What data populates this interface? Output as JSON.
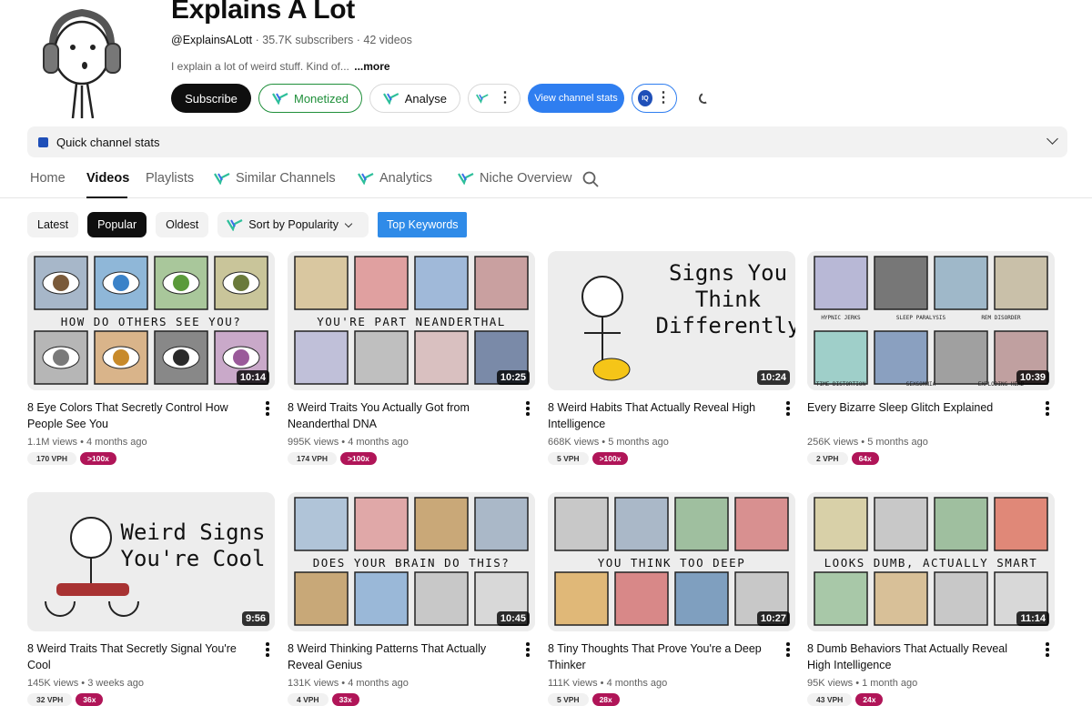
{
  "channel": {
    "name": "Explains A Lot",
    "handle": "@ExplainsALott",
    "stats": "· 35.7K subscribers · 42 videos",
    "description": "I explain a lot of weird stuff. Kind of...",
    "more_label": "...more"
  },
  "actions": {
    "subscribe": "Subscribe",
    "monetized": "Monetized",
    "analyse": "Analyse",
    "view_stats": "View channel stats",
    "vq_badge": "IQ"
  },
  "quick_stats": {
    "label": "Quick channel stats"
  },
  "tabs": {
    "home": "Home",
    "videos": "Videos",
    "playlists": "Playlists",
    "similar": "Similar Channels",
    "analytics": "Analytics",
    "niche": "Niche Overview"
  },
  "filters": {
    "latest": "Latest",
    "popular": "Popular",
    "oldest": "Oldest",
    "sort": "Sort by Popularity",
    "keywords": "Top Keywords"
  },
  "colors": {
    "accent_blue": "#2f7ef0",
    "monetized_green": "#1f8f3a",
    "badge_red": "#b01558"
  },
  "videos": [
    {
      "title": "8 Eye Colors That Secretly Control How People See You",
      "meta": "1.1M views • 4 months ago",
      "vph": "170 VPH",
      "mult": ">100x",
      "duration": "10:14",
      "thumb_text": "HOW DO OTHERS SEE YOU?"
    },
    {
      "title": "8 Weird Traits You Actually Got from Neanderthal DNA",
      "meta": "995K views • 4 months ago",
      "vph": "174 VPH",
      "mult": ">100x",
      "duration": "10:25",
      "thumb_text": "YOU'RE PART NEANDERTHAL"
    },
    {
      "title": "8 Weird Habits That Actually Reveal High Intelligence",
      "meta": "668K views • 5 months ago",
      "vph": "5 VPH",
      "mult": ">100x",
      "duration": "10:24",
      "thumb_text": "Signs You Think Differently"
    },
    {
      "title": "Every Bizarre Sleep Glitch Explained",
      "meta": "256K views • 5 months ago",
      "vph": "2 VPH",
      "mult": "64x",
      "duration": "10:39",
      "thumb_text": ""
    },
    {
      "title": "8 Weird Traits That Secretly Signal You're Cool",
      "meta": "145K views • 3 weeks ago",
      "vph": "32 VPH",
      "mult": "36x",
      "duration": "9:56",
      "thumb_text": "Weird Signs You're Cool"
    },
    {
      "title": "8 Weird Thinking Patterns That Actually Reveal Genius",
      "meta": "131K views • 4 months ago",
      "vph": "4 VPH",
      "mult": "33x",
      "duration": "10:45",
      "thumb_text": "DOES YOUR BRAIN DO THIS?"
    },
    {
      "title": "8 Tiny Thoughts That Prove You're a Deep Thinker",
      "meta": "111K views • 4 months ago",
      "vph": "5 VPH",
      "mult": "28x",
      "duration": "10:27",
      "thumb_text": "YOU THINK TOO DEEP"
    },
    {
      "title": "8 Dumb Behaviors That Actually Reveal High Intelligence",
      "meta": "95K views • 1 month ago",
      "vph": "43 VPH",
      "mult": "24x",
      "duration": "11:14",
      "thumb_text": "LOOKS DUMB, ACTUALLY SMART"
    }
  ],
  "sleep_labels": [
    "HYPNIC JERKS",
    "SLEEP PARALYSIS",
    "REM DISORDER",
    "TIME DISTORTION",
    "SEXSOMNIA",
    "EXPLODING HEAD"
  ]
}
